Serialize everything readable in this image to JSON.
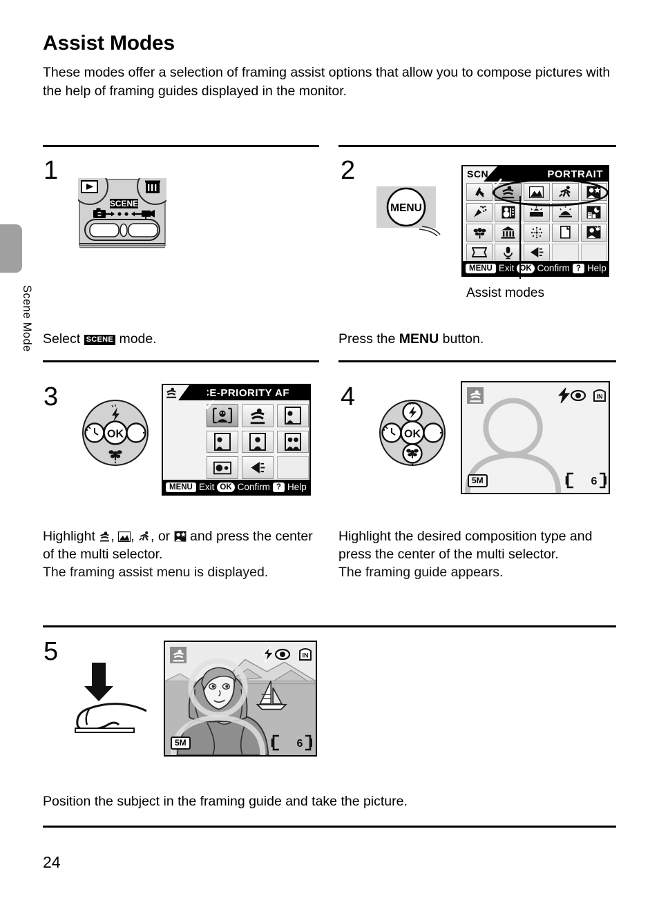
{
  "page": {
    "number": "24",
    "side_tab_label": "Scene Mode",
    "title": "Assist Modes",
    "intro": "These modes offer a selection of framing assist options that allow you to compose pictures with the help of framing guides displayed in the monitor."
  },
  "steps": {
    "one": {
      "number": "1",
      "caption_pre": "Select ",
      "caption_badge": "SCENE",
      "caption_post": " mode.",
      "art": {
        "mode_label": "SCENE",
        "playback_icon": "playback-icon",
        "delete_icon": "trash-icon",
        "camera_icon": "camera-icon",
        "movie_icon": "movie-camera-icon"
      }
    },
    "two": {
      "number": "2",
      "caption_pre": "Press the ",
      "caption_bold": "MENU",
      "caption_post": " button.",
      "button_label": "MENU",
      "annotation": "Assist modes",
      "screen": {
        "mode_tag": "SCN",
        "title": "PORTRAIT",
        "footer": [
          {
            "key": "MENU",
            "label": "Exit"
          },
          {
            "key": "OK",
            "label": "Confirm"
          },
          {
            "key": "?",
            "label": "Help"
          }
        ],
        "icons": [
          "assist-portrait-icon",
          "landscape-icon",
          "sports-icon",
          "night-portrait-icon",
          "party-icon",
          "beach-snow-icon",
          "sunset-icon",
          "dusk-dawn-icon",
          "night-landscape-icon",
          "close-up-icon",
          "museum-icon",
          "fireworks-icon",
          "copy-icon",
          "backlight-icon",
          "panorama-icon",
          "voice-recording-icon",
          "flash-icon",
          "",
          ""
        ],
        "selected_index": 0,
        "first_cell_icon": "sports-assist-icon"
      }
    },
    "three": {
      "number": "3",
      "caption_pre": "Highlight ",
      "caption_icons": [
        "portrait-icon",
        "landscape-icon",
        "sports-icon",
        "night-portrait-icon"
      ],
      "caption_mid": ", or ",
      "caption_post": " and press the center of the multi selector.",
      "caption_sub": "The framing assist menu is displayed.",
      "screen": {
        "title": "FACE-PRIORITY AF",
        "mode_tag": "portrait-assist-icon",
        "footer": [
          {
            "key": "MENU",
            "label": "Exit"
          },
          {
            "key": "OK",
            "label": "Confirm"
          },
          {
            "key": "?",
            "label": "Help"
          }
        ],
        "icons": [
          "face-priority-af-icon",
          "portrait-assist-icon",
          "portrait-left-icon",
          "portrait-right-icon",
          "portrait-center-icon",
          "portrait-two-icon",
          "portrait-closeup-icon",
          "back-arrow-icon",
          ""
        ],
        "selected_index": 0
      },
      "dial": {
        "flash_icon": "flash-icon",
        "selftimer_icon": "self-timer-icon",
        "ok_label": "OK",
        "macro_icon": "macro-flower-icon"
      }
    },
    "four": {
      "number": "4",
      "caption": "Highlight the desired composition type and press the center of the multi selector.",
      "caption_sub": "The framing guide appears.",
      "screen": {
        "mode_icon": "portrait-assist-icon",
        "flash_icon": "flash-redeye-icon",
        "memory_icon": "internal-memory-icon",
        "image_size": "5M",
        "battery_icon": "battery-icon",
        "shots_remaining": "6"
      },
      "dial": {
        "flash_icon": "flash-icon",
        "selftimer_icon": "self-timer-icon",
        "ok_label": "OK",
        "macro_icon": "macro-flower-icon"
      }
    },
    "five": {
      "number": "5",
      "caption": "Position the subject in the framing guide and take the picture.",
      "art": "hand-pressing-shutter-icon",
      "screen": {
        "mode_icon": "portrait-assist-icon",
        "flash_icon": "flash-redeye-icon",
        "memory_icon": "internal-memory-icon",
        "image_size": "5M",
        "battery_icon": "battery-icon",
        "shots_remaining": "6"
      }
    }
  },
  "colors": {
    "ink": "#000000",
    "lcd_bg": "#f2f2f2",
    "tab_gray": "#a0a0a0",
    "guide_gray": "#bdbdbd"
  }
}
